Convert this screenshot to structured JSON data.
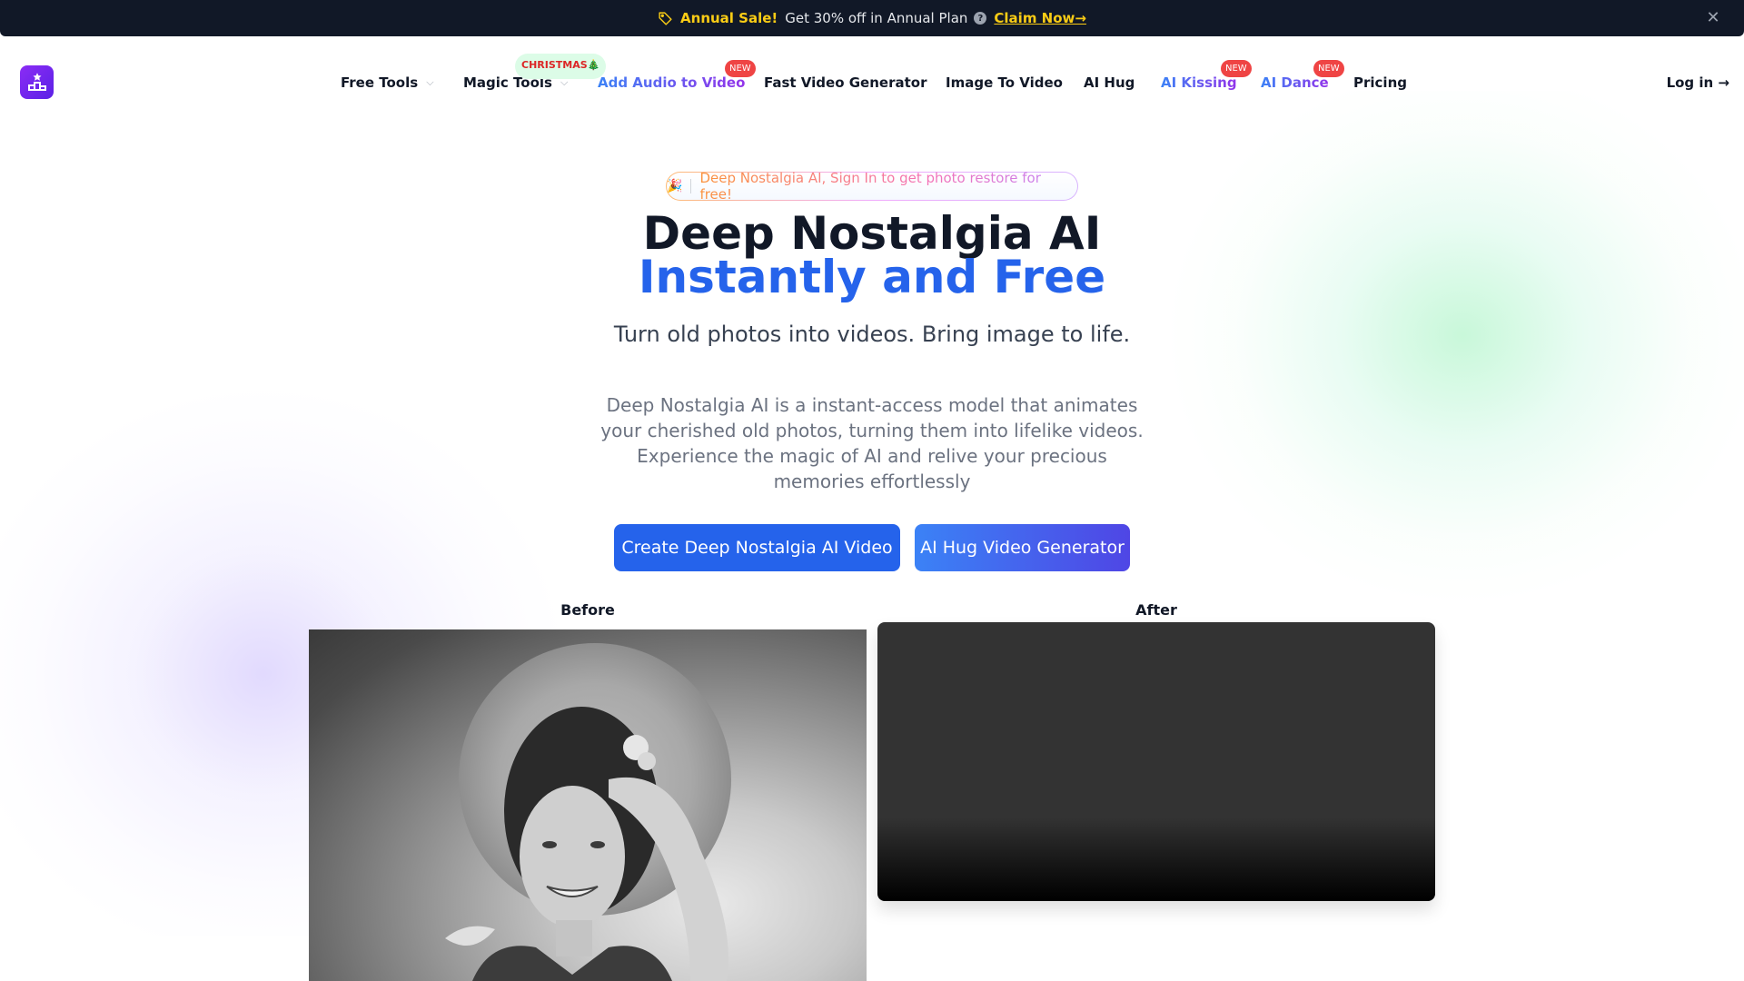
{
  "announcement": {
    "icon": "tag-icon",
    "sale_label": "Annual Sale!",
    "message": "Get 30% off in Annual Plan",
    "help_icon": "question-circle-icon",
    "help_glyph": "?",
    "cta_label": "Claim Now→",
    "close_glyph": "✕",
    "colors": {
      "background": "#111827",
      "highlight": "#facc15"
    }
  },
  "nav": {
    "logo_icon": "podium-star-icon",
    "items": [
      {
        "label": "Free Tools",
        "has_dropdown": true,
        "chevron": "⌵"
      },
      {
        "label": "Magic Tools",
        "has_dropdown": true,
        "chevron": "⌵",
        "badge": "CHRISTMAS🎄"
      },
      {
        "label": "Add Audio to Video",
        "badge": "NEW"
      },
      {
        "label": "Fast Video Generator"
      },
      {
        "label": "Image To Video"
      },
      {
        "label": "AI Hug"
      },
      {
        "label": "AI Kissing",
        "badge": "NEW"
      },
      {
        "label": "AI Dance",
        "badge": "NEW"
      },
      {
        "label": "Pricing"
      }
    ],
    "login_label": "Log in →"
  },
  "hero": {
    "promo_emoji": "🎉",
    "promo_text": "Deep Nostalgia AI, Sign In to get photo restore for free!",
    "title_line1": "Deep Nostalgia AI",
    "title_line2": "Instantly and Free",
    "subtitle": "Turn old photos into videos. Bring image to life.",
    "description": "Deep Nostalgia AI is a instant-access model that animates your cherished old photos, turning them into lifelike videos. Experience the magic of AI and relive your precious memories effortlessly",
    "primary_button": "Create Deep Nostalgia AI Video",
    "secondary_button": "AI Hug Video Generator",
    "colors": {
      "title": "#111827",
      "accent": "#2563eb"
    }
  },
  "comparison": {
    "before_label": "Before",
    "after_label": "After",
    "before_image": "black-and-white photo of smiling woman in straw hat saluting",
    "after_media": "video player (loading)"
  }
}
